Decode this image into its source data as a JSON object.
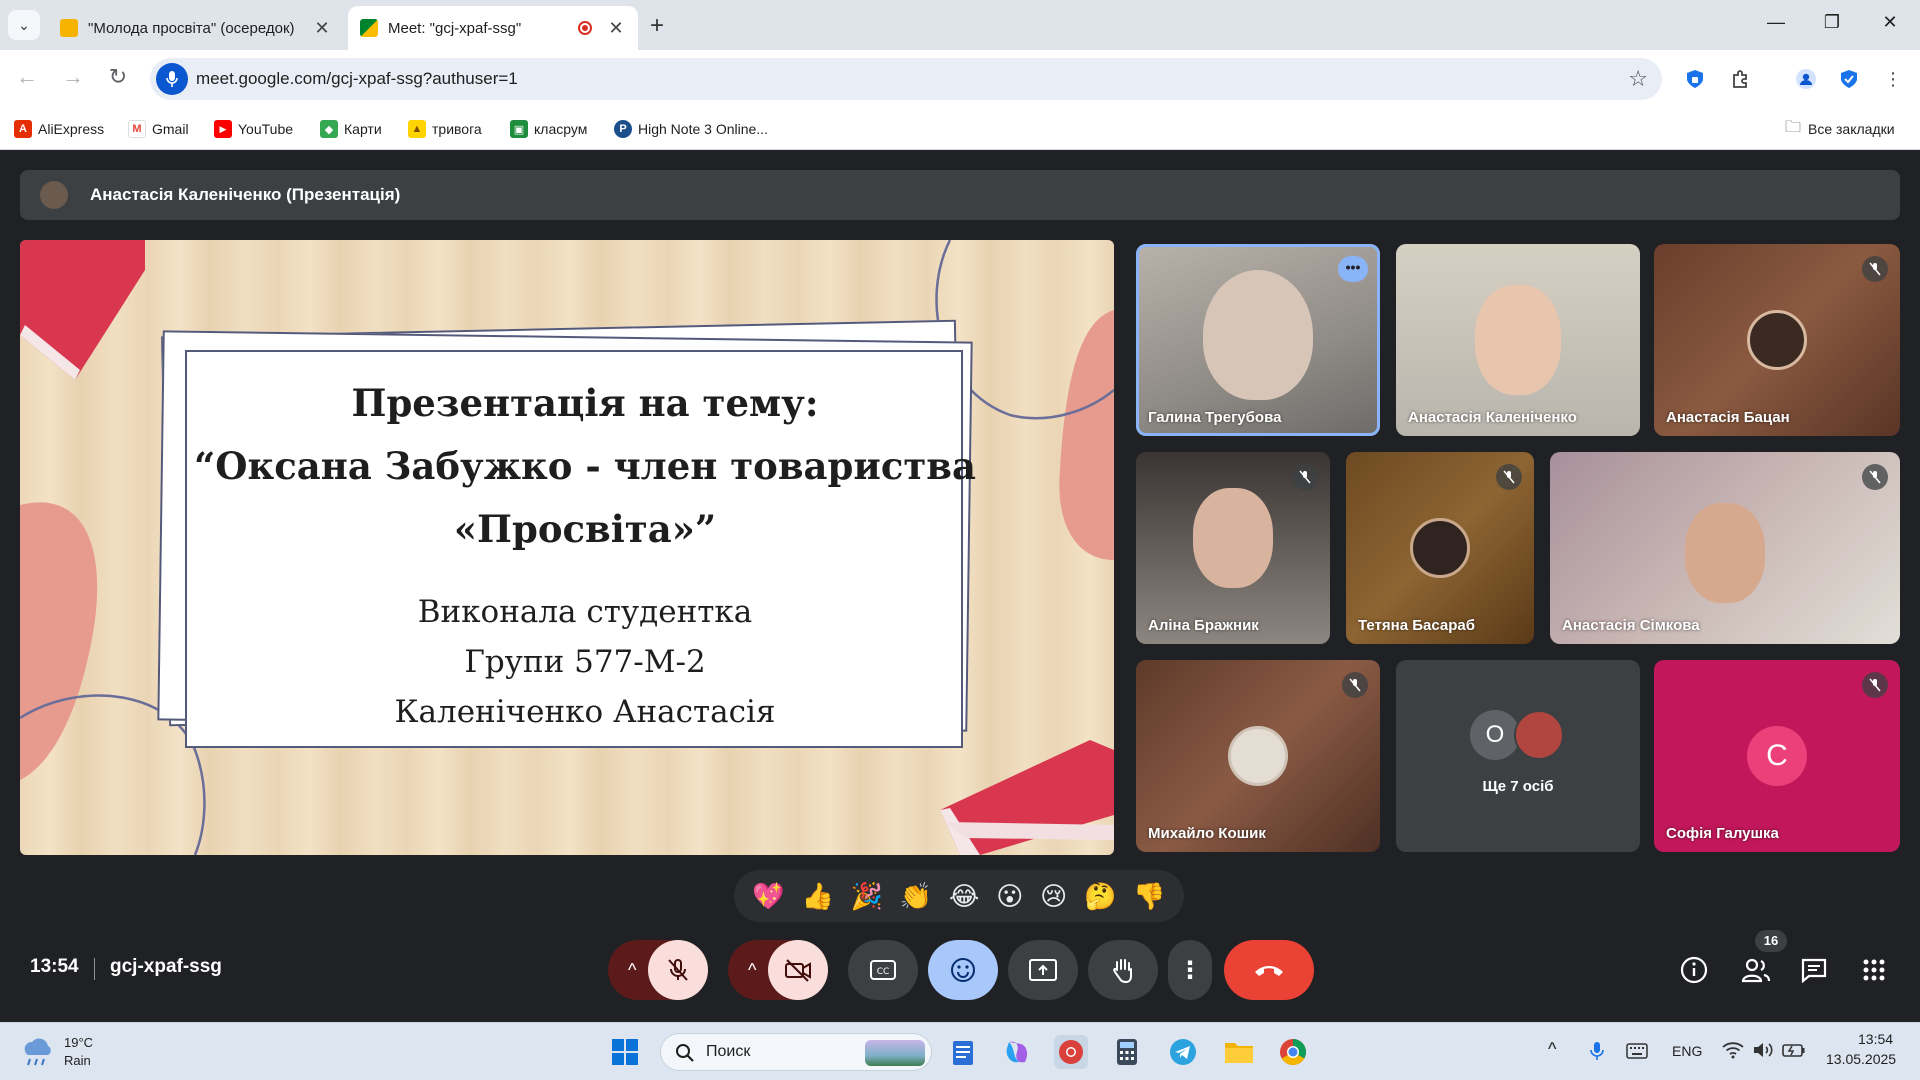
{
  "browser": {
    "tabs": [
      {
        "title": "\"Молода просвіта\" (осередок)",
        "active": false
      },
      {
        "title": "Meet: \"gcj-xpaf-ssg\"",
        "active": true
      }
    ],
    "url": "meet.google.com/gcj-xpaf-ssg?authuser=1",
    "bookmarks": [
      "AliExpress",
      "Gmail",
      "YouTube",
      "Карти",
      "тривога",
      "класрум",
      "High Note 3 Online..."
    ],
    "all_bookmarks": "Все закладки"
  },
  "meet": {
    "presenter_label": "Анастасія Каленіченко (Презентація)",
    "slide": {
      "title_lines": [
        "Презентація на тему:",
        "“Оксана Забужко - член товариства",
        "«Просвіта»”"
      ],
      "sub_lines": [
        "Виконала студентка",
        "Групи 577-М-2",
        "Каленіченко Анастасія"
      ]
    },
    "participants": [
      {
        "name": "Галина Трегубова"
      },
      {
        "name": "Анастасія Каленіченко"
      },
      {
        "name": "Анастасія Бацан"
      },
      {
        "name": "Аліна Бражник"
      },
      {
        "name": "Тетяна Басараб"
      },
      {
        "name": "Анастасія Сімкова"
      },
      {
        "name": "Михайло Кошик"
      },
      {
        "name": "Ще 7 осіб",
        "initial": "О"
      },
      {
        "name": "Софія Галушка",
        "initial": "С"
      }
    ],
    "reactions": [
      "💖",
      "👍",
      "🎉",
      "👏",
      "😂",
      "😮",
      "😢",
      "🤔",
      "👎"
    ],
    "time": "13:54",
    "meeting_code": "gcj-xpaf-ssg",
    "people_count": "16",
    "colors": {
      "accent_blue": "#8ab4f8",
      "end_call": "#ea4335",
      "tile_pink": "#c2185b"
    }
  },
  "taskbar": {
    "weather_temp": "19°C",
    "weather_text": "Rain",
    "search_placeholder": "Поиск",
    "language": "ENG",
    "time": "13:54",
    "date": "13.05.2025"
  }
}
